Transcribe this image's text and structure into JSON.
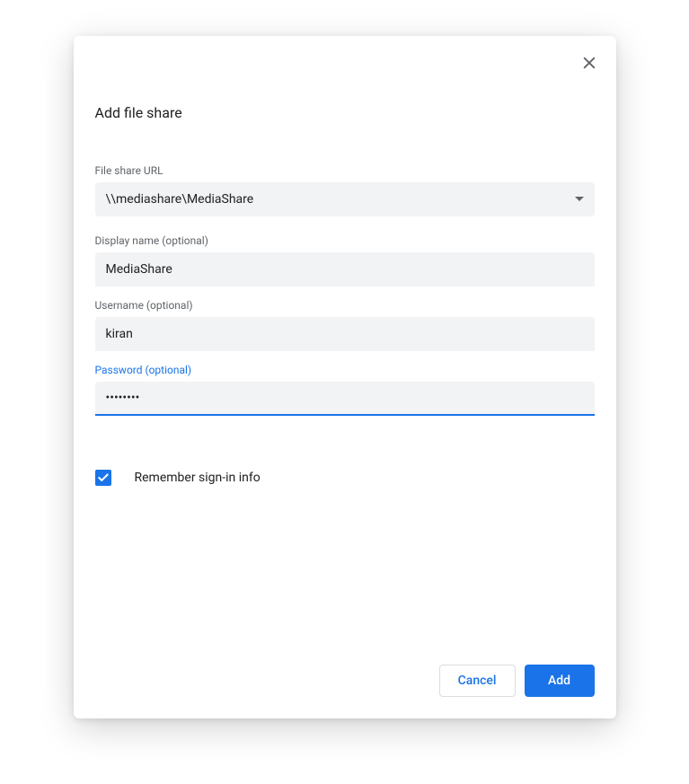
{
  "dialog": {
    "title": "Add file share",
    "fields": {
      "file_share_url": {
        "label": "File share URL",
        "value": "\\\\mediashare\\MediaShare"
      },
      "display_name": {
        "label": "Display name (optional)",
        "value": "MediaShare"
      },
      "username": {
        "label": "Username (optional)",
        "value": "kiran"
      },
      "password": {
        "label": "Password (optional)",
        "value": "••••••••"
      }
    },
    "remember": {
      "label": "Remember sign-in info",
      "checked": true
    },
    "buttons": {
      "cancel": "Cancel",
      "add": "Add"
    }
  }
}
